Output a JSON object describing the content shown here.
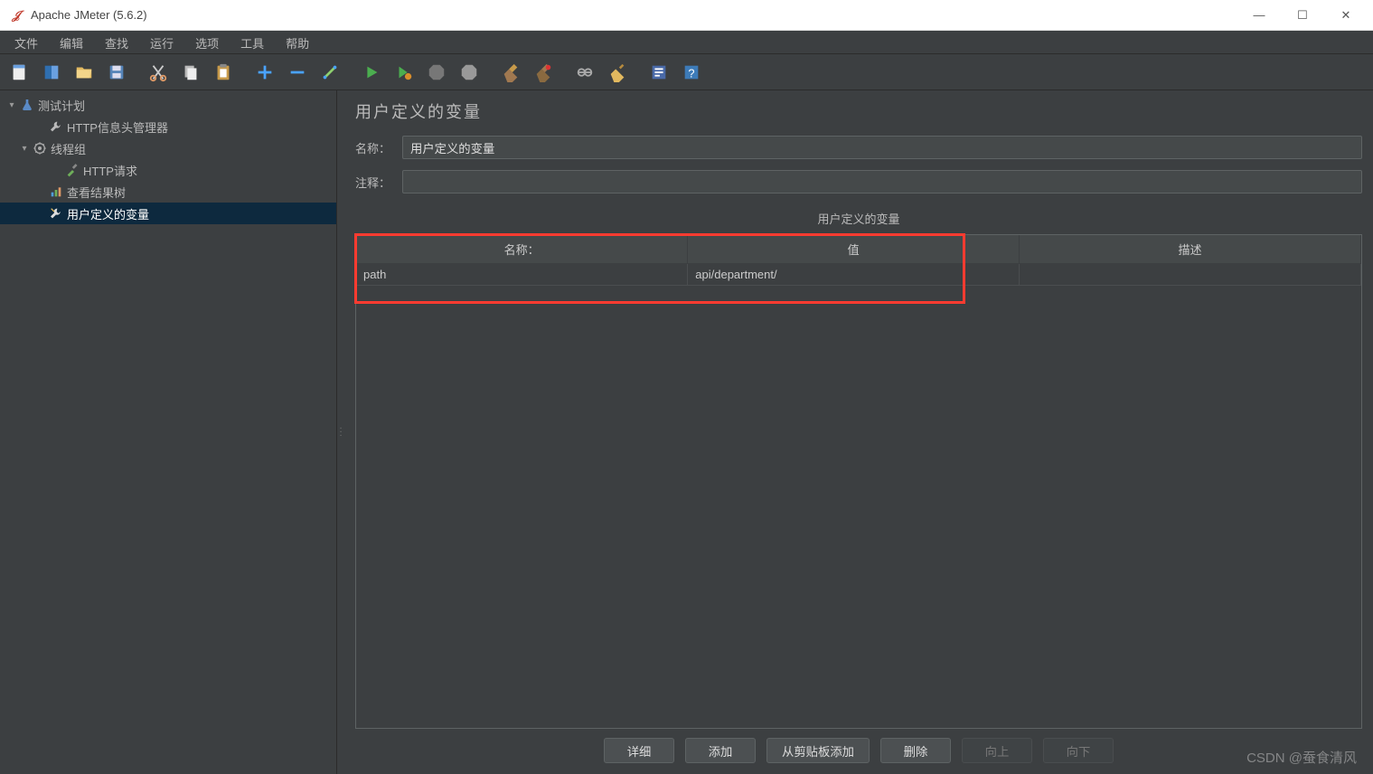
{
  "window": {
    "title": "Apache JMeter (5.6.2)",
    "min": "—",
    "max": "☐",
    "close": "✕"
  },
  "menubar": {
    "items": [
      "文件",
      "编辑",
      "查找",
      "运行",
      "选项",
      "工具",
      "帮助"
    ]
  },
  "tree": {
    "items": [
      {
        "label": "测试计划",
        "icon": "flask"
      },
      {
        "label": "HTTP信息头管理器",
        "icon": "wrench"
      },
      {
        "label": "线程组",
        "icon": "gear"
      },
      {
        "label": "HTTP请求",
        "icon": "dropper"
      },
      {
        "label": "查看结果树",
        "icon": "chart"
      },
      {
        "label": "用户定义的变量",
        "icon": "wrench"
      }
    ]
  },
  "editor": {
    "title": "用户定义的变量",
    "name_label": "名称：",
    "name_value": "用户定义的变量",
    "comment_label": "注释：",
    "comment_value": "",
    "vars_heading": "用户定义的变量",
    "columns": {
      "name": "名称：",
      "value": "值",
      "desc": "描述"
    },
    "rows": [
      {
        "name": "path",
        "value": "api/department/",
        "desc": ""
      }
    ],
    "buttons": {
      "detail": "详细",
      "add": "添加",
      "from_clipboard": "从剪贴板添加",
      "delete": "删除",
      "up": "向上",
      "down": "向下"
    }
  },
  "watermark": "CSDN @蚕食清风"
}
